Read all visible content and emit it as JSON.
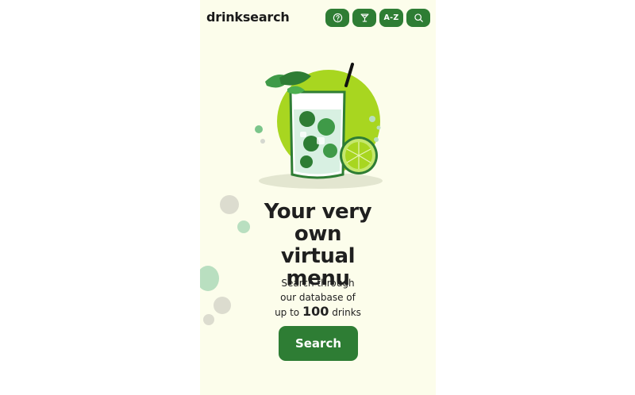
{
  "app": {
    "brand": "drinksearch"
  },
  "nav": {
    "help_icon": "question-circle-icon",
    "cocktail_icon": "cocktail-glass-icon",
    "az_label": "A-Z",
    "search_icon": "search-icon"
  },
  "hero": {
    "title": "Your very own virtual menu",
    "description_lines": [
      "Search through",
      "our database of"
    ],
    "count_prefix": "up to",
    "count": "100",
    "count_suffix": "drinks",
    "cta_label": "Search"
  },
  "colors": {
    "background": "#fcfdeb",
    "accent": "#2e7d34",
    "lime": "#a8d620",
    "text": "#1f1f1f"
  }
}
